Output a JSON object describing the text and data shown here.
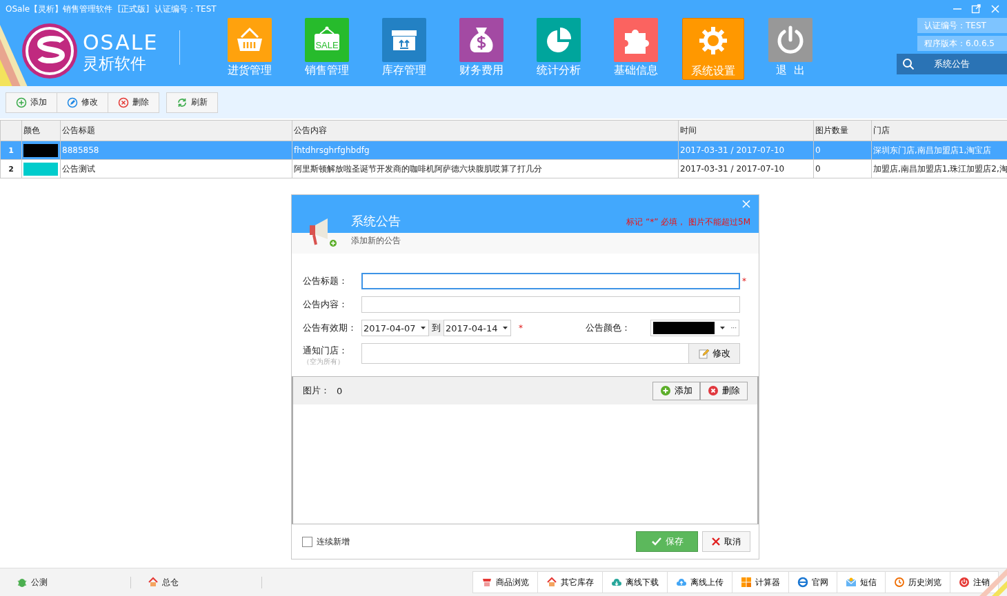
{
  "window": {
    "title": "OSale【灵析】销售管理软件  [正式版]  认证编号：TEST"
  },
  "logo": {
    "name": "OSALE",
    "subtitle": "灵析软件"
  },
  "modules": [
    {
      "label": "进货管理",
      "kind": "basket",
      "color": "#ffa20d",
      "selected": false
    },
    {
      "label": "销售管理",
      "kind": "sale",
      "badge_text": "SALE",
      "color": "#27bb2c",
      "selected": false
    },
    {
      "label": "库存管理",
      "kind": "box",
      "color": "#2381c4",
      "selected": false
    },
    {
      "label": "财务费用",
      "kind": "money",
      "color": "#a34aa3",
      "selected": false
    },
    {
      "label": "统计分析",
      "kind": "pie",
      "color": "#00a59c",
      "selected": false
    },
    {
      "label": "基础信息",
      "kind": "puzzle",
      "color": "#fb6360",
      "selected": false
    },
    {
      "label": "系统设置",
      "kind": "gear",
      "color": "#ff9800",
      "selected": true
    },
    {
      "label": "退  出",
      "kind": "power",
      "color": "#989898",
      "selected": false
    }
  ],
  "info": [
    "认证编号：TEST",
    "程序版本：6.0.6.5"
  ],
  "notice_button": {
    "label": "系统公告"
  },
  "toolbar": [
    {
      "label": "添加",
      "kind": "add"
    },
    {
      "label": "修改",
      "kind": "edit"
    },
    {
      "label": "删除",
      "kind": "delete"
    },
    {
      "label": "刷新",
      "kind": "refresh"
    }
  ],
  "table": {
    "columns": [
      "",
      "颜色",
      "公告标题",
      "公告内容",
      "时间",
      "图片数量",
      "门店"
    ],
    "rows": [
      {
        "color": "#000000",
        "selected": true,
        "cells": [
          "1",
          "",
          "8885858",
          "fhtdhrsghrfghbdfg",
          "2017-03-31 / 2017-07-10",
          "0",
          "深圳东门店,南昌加盟店1,淘宝店"
        ]
      },
      {
        "color": "#00cccc",
        "selected": false,
        "cells": [
          "2",
          "",
          "公告测试",
          "阿里斯顿解放啦圣诞节开发商的咖啡机阿萨德六块腹肌哎算了打几分",
          "2017-03-31 / 2017-07-10",
          "0",
          "加盟店,南昌加盟店1,珠江加盟店2,淘"
        ]
      }
    ]
  },
  "dialog": {
    "title": "系统公告",
    "subtitle": "添加新的公告",
    "hint": "标记 “*” 必填， 图片不能超过5M",
    "title_label": "公告标题：",
    "title_required": "*",
    "content_label": "公告内容：",
    "period_label": "公告有效期：",
    "start_date": "2017-04-07",
    "to_label": "到",
    "end_date": "2017-04-14",
    "period_required": "*",
    "color_label": "公告颜色：",
    "color": "#000000",
    "color_more": "···",
    "stores_label": "通知门店：",
    "stores_hint": "（空为所有）",
    "stores_button": "修改",
    "images_label": "图片：",
    "images_count": "0",
    "image_buttons": [
      {
        "label": "添加",
        "kind": "add"
      },
      {
        "label": "删除",
        "kind": "delete"
      }
    ],
    "continuous": {
      "label": "连续新增",
      "checked": false
    },
    "save": "保存",
    "cancel": "取消"
  },
  "status_bar": {
    "left": [
      {
        "label": "公测",
        "kind": "bug"
      },
      {
        "label": "总仓",
        "kind": "house"
      }
    ],
    "right": [
      {
        "label": "商品浏览",
        "kind": "shop"
      },
      {
        "label": "其它库存",
        "kind": "house"
      },
      {
        "label": "离线下载",
        "kind": "download"
      },
      {
        "label": "离线上传",
        "kind": "upload"
      },
      {
        "label": "计算器",
        "kind": "calc"
      },
      {
        "label": "官网",
        "kind": "web"
      },
      {
        "label": "短信",
        "kind": "mail"
      },
      {
        "label": "历史浏览",
        "kind": "history"
      },
      {
        "label": "注销",
        "kind": "logout"
      }
    ]
  }
}
